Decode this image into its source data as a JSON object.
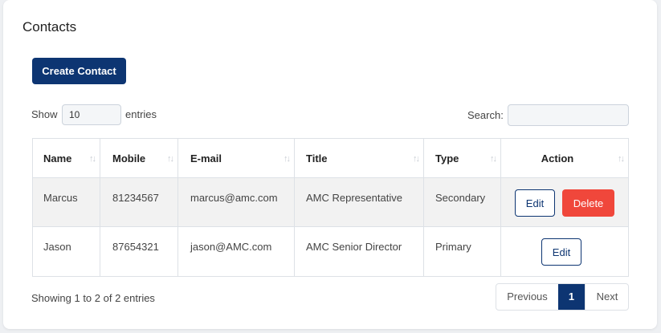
{
  "page": {
    "title": "Contacts"
  },
  "toolbar": {
    "create_label": "Create Contact"
  },
  "length": {
    "show_label": "Show",
    "value": "10",
    "entries_label": "entries"
  },
  "search": {
    "label": "Search:",
    "value": ""
  },
  "table": {
    "columns": [
      "Name",
      "Mobile",
      "E-mail",
      "Title",
      "Type",
      "Action"
    ],
    "rows": [
      {
        "name": "Marcus",
        "mobile": "81234567",
        "email": "marcus@amc.com",
        "title": "AMC Representative",
        "type": "Secondary"
      },
      {
        "name": "Jason",
        "mobile": "87654321",
        "email": "jason@AMC.com",
        "title": "AMC Senior Director",
        "type": "Primary"
      }
    ],
    "edit_label": "Edit",
    "delete_label": "Delete",
    "sort_icon": "sort-arrows-icon"
  },
  "footer": {
    "info": "Showing 1 to 2 of 2 entries",
    "prev_label": "Previous",
    "page_label": "1",
    "next_label": "Next"
  },
  "colors": {
    "primary": "#0d3572",
    "danger": "#f0473b",
    "row_stripe": "#f2f2f2",
    "border": "#dde1e6",
    "background": "#eef0f3"
  }
}
